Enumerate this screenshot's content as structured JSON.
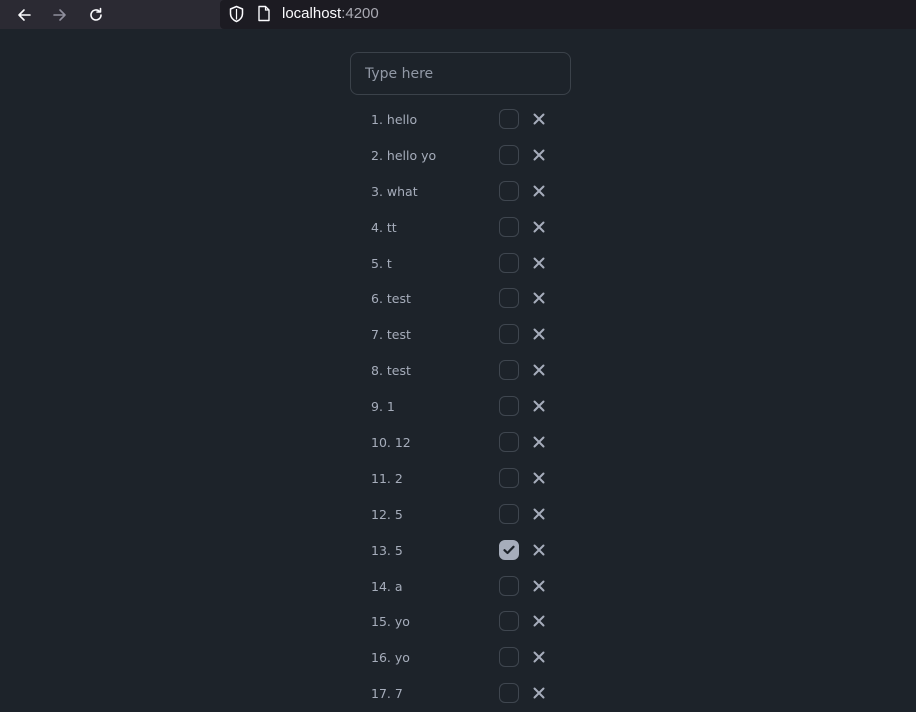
{
  "browser": {
    "url_host": "localhost",
    "url_port": ":4200"
  },
  "input": {
    "placeholder": "Type here"
  },
  "todos": [
    {
      "label": "1. hello",
      "done": false
    },
    {
      "label": "2. hello yo",
      "done": false
    },
    {
      "label": "3. what",
      "done": false
    },
    {
      "label": "4. tt",
      "done": false
    },
    {
      "label": "5. t",
      "done": false
    },
    {
      "label": "6. test",
      "done": false
    },
    {
      "label": "7. test",
      "done": false
    },
    {
      "label": "8. test",
      "done": false
    },
    {
      "label": "9. 1",
      "done": false
    },
    {
      "label": "10. 12",
      "done": false
    },
    {
      "label": "11. 2",
      "done": false
    },
    {
      "label": "12. 5",
      "done": false
    },
    {
      "label": "13. 5",
      "done": true
    },
    {
      "label": "14. a",
      "done": false
    },
    {
      "label": "15. yo",
      "done": false
    },
    {
      "label": "16. yo",
      "done": false
    },
    {
      "label": "17. 7",
      "done": false
    }
  ],
  "colors": {
    "page_background": "#1d232a",
    "text": "#a6adbb",
    "checkbox_border": "#3f464f",
    "checked_fill": "#a6adbb",
    "browser_chrome": "#2b2a33"
  }
}
